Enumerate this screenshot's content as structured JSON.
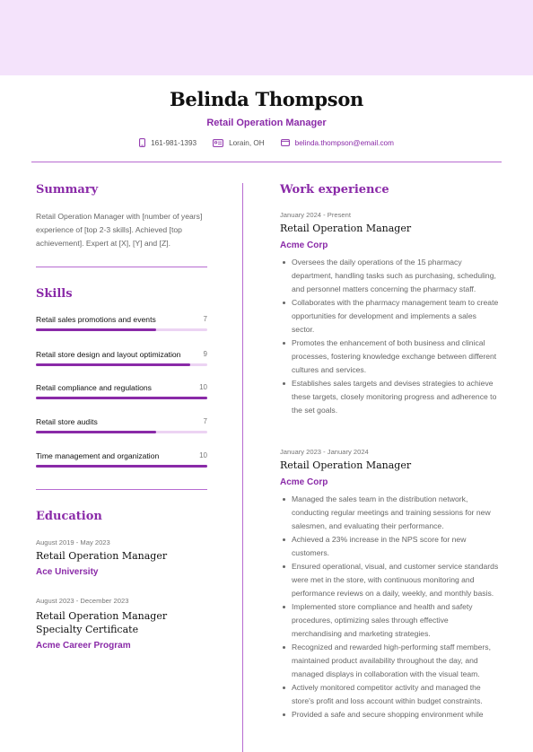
{
  "header": {
    "name": "Belinda Thompson",
    "title": "Retail Operation Manager",
    "contacts": [
      {
        "icon": "phone-icon",
        "text": "161-981-1393"
      },
      {
        "icon": "location-card-icon",
        "text": "Lorain, OH"
      },
      {
        "icon": "email-icon",
        "text": "belinda.thompson@email.com"
      }
    ]
  },
  "colors": {
    "accent": "#8a2aa8",
    "band": "#f4e3fb",
    "bar_track": "#ecd3f3"
  },
  "summary": {
    "heading": "Summary",
    "text": "Retail Operation Manager with [number of years] experience of [top 2-3 skills]. Achieved [top achievement]. Expert at [X], [Y] and [Z]."
  },
  "skills": {
    "heading": "Skills",
    "max": 10,
    "items": [
      {
        "label": "Retail sales promotions and events",
        "value": 7
      },
      {
        "label": "Retail store design and layout optimization",
        "value": 9
      },
      {
        "label": "Retail compliance and regulations",
        "value": 10
      },
      {
        "label": "Retail store audits",
        "value": 7
      },
      {
        "label": "Time management and organization",
        "value": 10
      }
    ]
  },
  "education": {
    "heading": "Education",
    "items": [
      {
        "date": "August 2019 - May 2023",
        "degree": "Retail Operation Manager",
        "school": "Ace University"
      },
      {
        "date": "August 2023 - December 2023",
        "degree": "Retail Operation Manager Specialty Certificate",
        "school": "Acme Career Program"
      }
    ]
  },
  "work": {
    "heading": "Work experience",
    "jobs": [
      {
        "date": "January 2024 - Present",
        "title": "Retail Operation Manager",
        "company": "Acme Corp",
        "bullets": [
          "Oversees the daily operations of the 15 pharmacy department, handling tasks such as purchasing, scheduling, and personnel matters concerning the pharmacy staff.",
          "Collaborates with the pharmacy management team to create opportunities for development and implements a sales sector.",
          "Promotes the enhancement of both business and clinical processes, fostering knowledge exchange between different cultures and services.",
          "Establishes sales targets and devises strategies to achieve these targets, closely monitoring progress and adherence to the set goals."
        ]
      },
      {
        "date": "January 2023 - January 2024",
        "title": "Retail Operation Manager",
        "company": "Acme Corp",
        "bullets": [
          "Managed the sales team in the distribution network, conducting regular meetings and training sessions for new salesmen, and evaluating their performance.",
          "Achieved a 23% increase in the NPS score for new customers.",
          "Ensured operational, visual, and customer service standards were met in the store, with continuous monitoring and performance reviews on a daily, weekly, and monthly basis.",
          "Implemented store compliance and health and safety procedures, optimizing sales through effective merchandising and marketing strategies.",
          "Recognized and rewarded high-performing staff members, maintained product availability throughout the day, and managed displays in collaboration with the visual team.",
          "Actively monitored competitor activity and managed the store's profit and loss account within budget constraints.",
          "Provided a safe and secure shopping environment while"
        ]
      }
    ]
  }
}
